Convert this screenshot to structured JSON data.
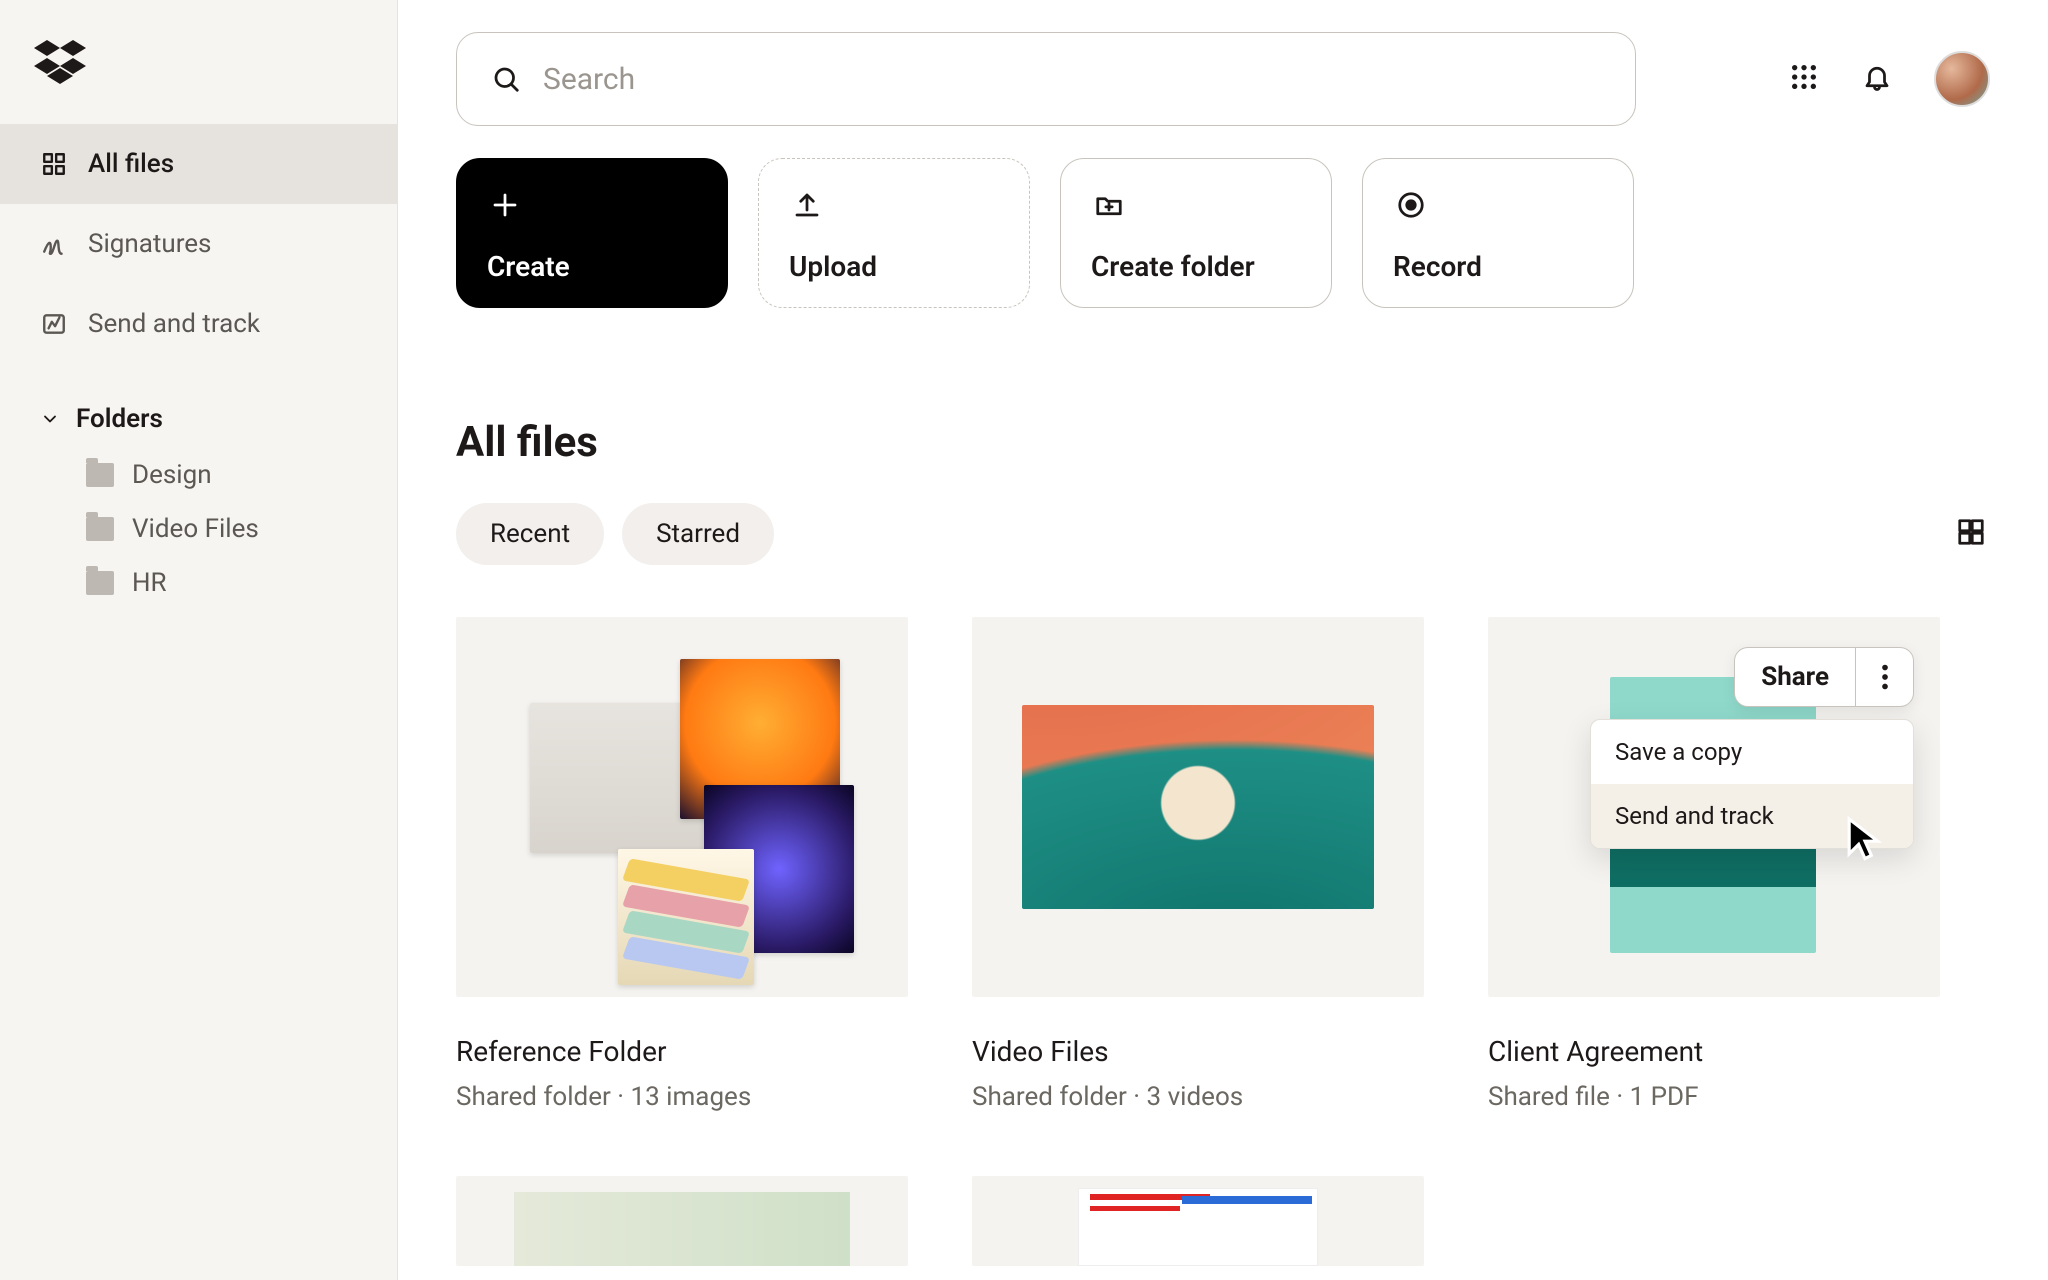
{
  "search": {
    "placeholder": "Search"
  },
  "sidebar": {
    "nav": [
      {
        "label": "All files"
      },
      {
        "label": "Signatures"
      },
      {
        "label": "Send and track"
      }
    ],
    "folders_header": "Folders",
    "folders": [
      {
        "label": "Design"
      },
      {
        "label": "Video Files"
      },
      {
        "label": "HR"
      }
    ]
  },
  "actions": {
    "create": "Create",
    "upload": "Upload",
    "create_folder": "Create folder",
    "record": "Record"
  },
  "page": {
    "title": "All files"
  },
  "filters": {
    "recent": "Recent",
    "starred": "Starred"
  },
  "cards": [
    {
      "name": "Reference Folder",
      "meta": "Shared folder · 13 images"
    },
    {
      "name": "Video Files",
      "meta": "Shared folder · 3 videos"
    },
    {
      "name": "Client Agreement",
      "meta": "Shared file · 1 PDF"
    }
  ],
  "card_overlay": {
    "share": "Share",
    "menu": [
      "Save a copy",
      "Send and track"
    ],
    "doc_title": "Client Agreement"
  }
}
